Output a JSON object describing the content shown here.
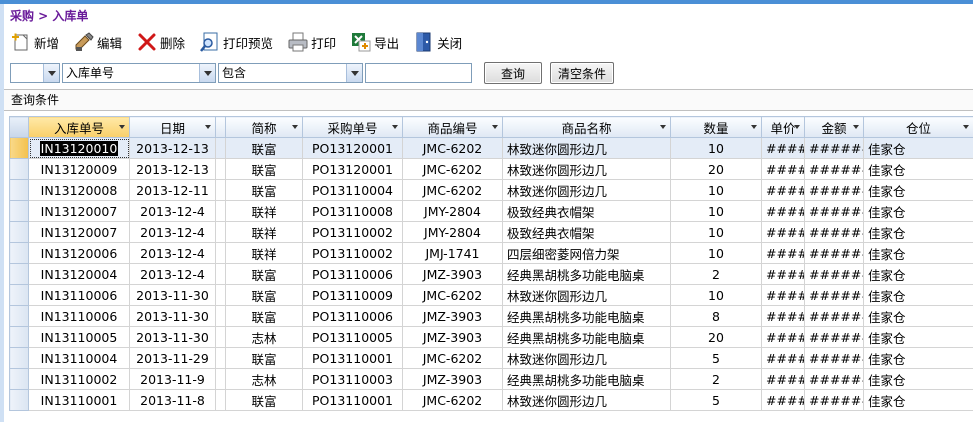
{
  "breadcrumb": "采购 > 入库单",
  "toolbar": {
    "add": "新增",
    "edit": "编辑",
    "delete": "删除",
    "print_preview": "打印预览",
    "print": "打印",
    "export": "导出",
    "close": "关闭"
  },
  "filter": {
    "logic_value": "",
    "field_value": "入库单号",
    "operator_value": "包含",
    "text_value": "",
    "query_button": "查询",
    "clear_button": "清空条件"
  },
  "query_conditions_label": "查询条件",
  "columns": [
    "入库单号",
    "日期",
    "",
    "简称",
    "采购单号",
    "商品编号",
    "商品名称",
    "数量",
    "单价",
    "金额",
    "仓位"
  ],
  "rows": [
    {
      "id": "IN13120010",
      "date": "2013-12-13",
      "abbr": "联富",
      "po": "PO13120001",
      "code": "JMC-6202",
      "name": "林致迷你圆形边几",
      "qty": "10",
      "price": "#####",
      "amount": "#######",
      "loc": "佳家仓"
    },
    {
      "id": "IN13120009",
      "date": "2013-12-13",
      "abbr": "联富",
      "po": "PO13120001",
      "code": "JMC-6202",
      "name": "林致迷你圆形边几",
      "qty": "20",
      "price": "#####",
      "amount": "#######",
      "loc": "佳家仓"
    },
    {
      "id": "IN13120008",
      "date": "2013-12-11",
      "abbr": "联富",
      "po": "PO13110004",
      "code": "JMC-6202",
      "name": "林致迷你圆形边几",
      "qty": "10",
      "price": "#####",
      "amount": "#######",
      "loc": "佳家仓"
    },
    {
      "id": "IN13120007",
      "date": "2013-12-4",
      "abbr": "联祥",
      "po": "PO13110008",
      "code": "JMY-2804",
      "name": "极致经典衣帽架",
      "qty": "10",
      "price": "#####",
      "amount": "#######",
      "loc": "佳家仓"
    },
    {
      "id": "IN13120007",
      "date": "2013-12-4",
      "abbr": "联祥",
      "po": "PO13110002",
      "code": "JMY-2804",
      "name": "极致经典衣帽架",
      "qty": "10",
      "price": "#####",
      "amount": "#######",
      "loc": "佳家仓"
    },
    {
      "id": "IN13120006",
      "date": "2013-12-4",
      "abbr": "联祥",
      "po": "PO13110002",
      "code": "JMJ-1741",
      "name": "四层细密菱网倍力架",
      "qty": "10",
      "price": "#####",
      "amount": "#######",
      "loc": "佳家仓"
    },
    {
      "id": "IN13120004",
      "date": "2013-12-4",
      "abbr": "联富",
      "po": "PO13110006",
      "code": "JMZ-3903",
      "name": "经典黑胡桃多功能电脑桌",
      "qty": "2",
      "price": "#####",
      "amount": "#######",
      "loc": "佳家仓"
    },
    {
      "id": "IN13110006",
      "date": "2013-11-30",
      "abbr": "联富",
      "po": "PO13110009",
      "code": "JMC-6202",
      "name": "林致迷你圆形边几",
      "qty": "10",
      "price": "#####",
      "amount": "#######",
      "loc": "佳家仓"
    },
    {
      "id": "IN13110006",
      "date": "2013-11-30",
      "abbr": "联富",
      "po": "PO13110006",
      "code": "JMZ-3903",
      "name": "经典黑胡桃多功能电脑桌",
      "qty": "8",
      "price": "#####",
      "amount": "#######",
      "loc": "佳家仓"
    },
    {
      "id": "IN13110005",
      "date": "2013-11-30",
      "abbr": "志林",
      "po": "PO13110005",
      "code": "JMZ-3903",
      "name": "经典黑胡桃多功能电脑桌",
      "qty": "20",
      "price": "#####",
      "amount": "#######",
      "loc": "佳家仓"
    },
    {
      "id": "IN13110004",
      "date": "2013-11-29",
      "abbr": "联富",
      "po": "PO13110001",
      "code": "JMC-6202",
      "name": "林致迷你圆形边几",
      "qty": "5",
      "price": "#####",
      "amount": "#######",
      "loc": "佳家仓"
    },
    {
      "id": "IN13110002",
      "date": "2013-11-9",
      "abbr": "志林",
      "po": "PO13110003",
      "code": "JMZ-3903",
      "name": "经典黑胡桃多功能电脑桌",
      "qty": "2",
      "price": "#####",
      "amount": "#######",
      "loc": "佳家仓"
    },
    {
      "id": "IN13110001",
      "date": "2013-11-8",
      "abbr": "联富",
      "po": "PO13110001",
      "code": "JMC-6202",
      "name": "林致迷你圆形边几",
      "qty": "5",
      "price": "#####",
      "amount": "#######",
      "loc": "佳家仓"
    }
  ],
  "selected_row": 0,
  "colors": {
    "accent": "#4a8fd6",
    "breadcrumb": "#6a1b9a",
    "sorted_header": "#f9cf69"
  }
}
